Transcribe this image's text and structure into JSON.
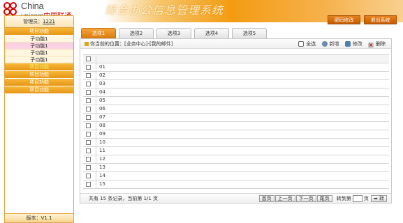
{
  "header": {
    "brand_en_1": "China",
    "brand_en_2": "unicom",
    "brand_cn": "中国联通",
    "system_title": "综合办公信息管理系统",
    "change_password": "密码修改",
    "logout": "退出系统"
  },
  "sidebar": {
    "admin_label": "管理员：",
    "admin_name": "1221",
    "menus": [
      {
        "label": "项目功能",
        "children": [
          "子功能1",
          "子功能1",
          "子功能1",
          "子功能1"
        ]
      },
      {
        "label": "项目功能"
      },
      {
        "label": "项目功能"
      },
      {
        "label": "项目功能"
      },
      {
        "label": "项目功能"
      }
    ],
    "version": "版本：V1.1"
  },
  "tabs": [
    "选项1",
    "选项2",
    "选项3",
    "选项4",
    "选项5"
  ],
  "toolbar": {
    "location": "你当前的位置：[业务中心]-[我的邮件]",
    "select_all": "全选",
    "add": "新增",
    "edit": "修改",
    "delete": "删除"
  },
  "rows": [
    "01",
    "02",
    "03",
    "04",
    "05",
    "06",
    "07",
    "08",
    "09",
    "10",
    "11",
    "12",
    "13",
    "14",
    "15"
  ],
  "footer": {
    "summary": "共有 15 条记录，当前第 1/1 页",
    "first": "首页",
    "prev": "上一页",
    "next": "下一页",
    "last": "尾页",
    "jump_label": "转到第",
    "page_unit": "页",
    "go": "➡ 转"
  },
  "colors": {
    "accent": "#f39c12",
    "brand_red": "#d40000"
  }
}
